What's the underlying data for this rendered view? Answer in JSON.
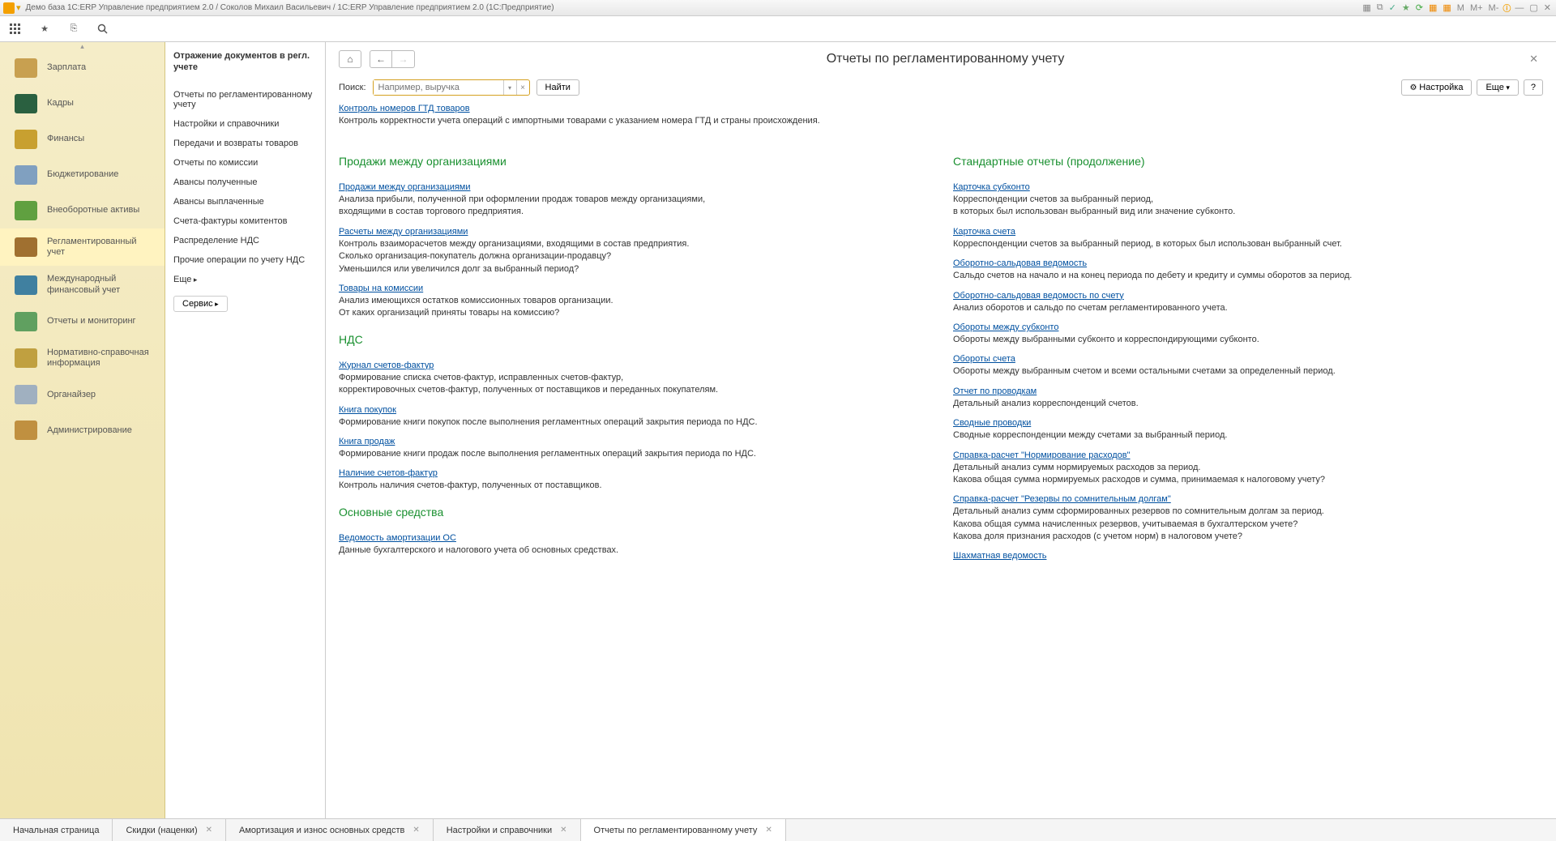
{
  "titlebar": {
    "title": "Демо база 1С:ERP Управление предприятием 2.0 / Соколов Михаил Васильевич / 1С:ERP Управление предприятием 2.0  (1С:Предприятие)",
    "mem_buttons": [
      "M",
      "M+",
      "M-"
    ]
  },
  "sidebar": {
    "items": [
      {
        "label": "Зарплата",
        "icon": "salary"
      },
      {
        "label": "Кадры",
        "icon": "hr"
      },
      {
        "label": "Финансы",
        "icon": "finance"
      },
      {
        "label": "Бюджетирование",
        "icon": "budget"
      },
      {
        "label": "Внеоборотные активы",
        "icon": "assets"
      },
      {
        "label": "Регламентированный учет",
        "icon": "regulated",
        "active": true
      },
      {
        "label": "Международный финансовый учет",
        "icon": "intl"
      },
      {
        "label": "Отчеты и мониторинг",
        "icon": "reports"
      },
      {
        "label": "Нормативно-справочная информация",
        "icon": "refs"
      },
      {
        "label": "Органайзер",
        "icon": "organizer"
      },
      {
        "label": "Администрирование",
        "icon": "admin"
      }
    ]
  },
  "subpanel": {
    "title": "Отражение документов в регл. учете",
    "links": [
      "Отчеты по регламентированному учету",
      "Настройки и справочники",
      "Передачи и возвраты товаров",
      "Отчеты по комиссии",
      "Авансы полученные",
      "Авансы выплаченные",
      "Счета-фактуры комитентов",
      "Распределение НДС",
      "Прочие операции по учету НДС"
    ],
    "more": "Еще",
    "service": "Сервис"
  },
  "content": {
    "title": "Отчеты по регламентированному учету",
    "search_label": "Поиск:",
    "search_placeholder": "Например, выручка",
    "btn_find": "Найти",
    "btn_cfg": "Настройка",
    "btn_more": "Еще",
    "btn_help": "?",
    "intro_link": "Контроль номеров ГТД товаров",
    "intro_desc": "Контроль корректности учета операций с импортными товарами с указанием номера ГТД и страны происхождения.",
    "left": [
      {
        "title": "Продажи между организациями",
        "items": [
          {
            "link": "Продажи между организациями",
            "desc": "Анализа прибыли, полученной при оформлении продаж товаров между организациями,\nвходящими в состав торгового предприятия."
          },
          {
            "link": "Расчеты между организациями",
            "desc": "Контроль взаиморасчетов между организациями, входящими в состав предприятия.\nСколько организация-покупатель должна организации-продавцу?\nУменьшился или увеличился долг за выбранный период?"
          },
          {
            "link": "Товары на комиссии",
            "desc": "Анализ имеющихся остатков комиссионных товаров организации.\nОт каких организаций приняты товары на комиссию?"
          }
        ]
      },
      {
        "title": "НДС",
        "items": [
          {
            "link": "Журнал счетов-фактур",
            "desc": "Формирование списка счетов-фактур, исправленных счетов-фактур,\nкорректировочных счетов-фактур, полученных от поставщиков и переданных покупателям."
          },
          {
            "link": "Книга покупок",
            "desc": "Формирование книги покупок после выполнения регламентных операций закрытия периода по НДС."
          },
          {
            "link": "Книга продаж",
            "desc": "Формирование книги продаж после выполнения регламентных операций закрытия периода по НДС."
          },
          {
            "link": "Наличие счетов-фактур",
            "desc": "Контроль наличия счетов-фактур, полученных от поставщиков."
          }
        ]
      },
      {
        "title": "Основные средства",
        "items": [
          {
            "link": "Ведомость амортизации ОС",
            "desc": "Данные бухгалтерского и налогового учета об основных средствах."
          }
        ]
      }
    ],
    "right": [
      {
        "title": "Стандартные отчеты (продолжение)",
        "items": [
          {
            "link": "Карточка субконто",
            "desc": "Корреспонденции счетов за выбранный период,\nв которых был использован выбранный вид  или значение субконто."
          },
          {
            "link": "Карточка счета",
            "desc": "Корреспонденции счетов за выбранный период, в которых был использован выбранный счет."
          },
          {
            "link": "Оборотно-сальдовая ведомость",
            "desc": "Сальдо счетов на начало и на конец периода по дебету и кредиту и суммы оборотов за период."
          },
          {
            "link": "Оборотно-сальдовая ведомость по счету",
            "desc": "Анализ оборотов и сальдо по счетам регламентированного учета."
          },
          {
            "link": "Обороты между субконто",
            "desc": "Обороты между выбранными субконто и корреспондирующими субконто."
          },
          {
            "link": "Обороты счета",
            "desc": "Обороты между выбранным счетом и всеми остальными счетами за определенный период."
          },
          {
            "link": "Отчет по проводкам",
            "desc": "Детальный анализ корреспонденций счетов."
          },
          {
            "link": "Сводные проводки",
            "desc": "Сводные корреспонденции между счетами за выбранный период."
          },
          {
            "link": "Справка-расчет \"Нормирование расходов\"",
            "desc": "Детальный анализ сумм нормируемых расходов за период.\nКакова общая сумма нормируемых расходов и сумма, принимаемая к налоговому учету?"
          },
          {
            "link": "Справка-расчет \"Резервы по сомнительным долгам\"",
            "desc": "Детальный анализ сумм сформированных резервов по сомнительным долгам за период.\nКакова общая сумма начисленных резервов, учитываемая в бухгалтерском учете?\nКакова доля признания расходов (с учетом норм) в налоговом учете?"
          },
          {
            "link": "Шахматная ведомость",
            "desc": ""
          }
        ]
      }
    ]
  },
  "tabs": [
    {
      "label": "Начальная страница",
      "closable": false
    },
    {
      "label": "Скидки (наценки)",
      "closable": true
    },
    {
      "label": "Амортизация и износ основных средств",
      "closable": true
    },
    {
      "label": "Настройки и справочники",
      "closable": true
    },
    {
      "label": "Отчеты по регламентированному учету",
      "closable": true,
      "active": true
    }
  ]
}
